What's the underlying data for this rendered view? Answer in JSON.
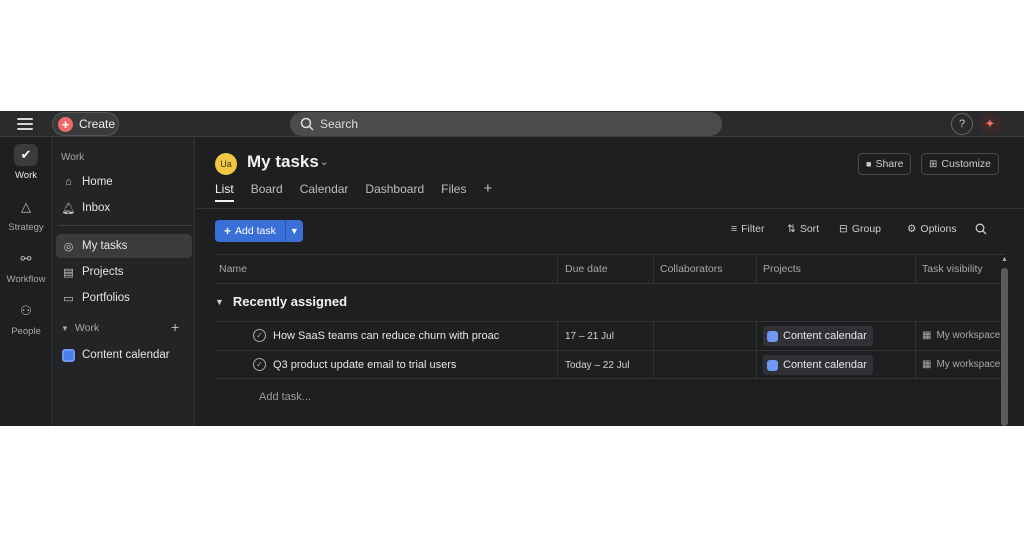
{
  "topbar": {
    "create_label": "Create",
    "search_placeholder": "Search",
    "help_label": "?"
  },
  "rail": {
    "items": [
      {
        "label": "Work",
        "icon": "check-circle-icon"
      },
      {
        "label": "Strategy",
        "icon": "triangle-icon"
      },
      {
        "label": "Workflow",
        "icon": "workflow-icon"
      },
      {
        "label": "People",
        "icon": "people-icon"
      }
    ]
  },
  "sidebar": {
    "section_label": "Work",
    "items": [
      {
        "label": "Home",
        "icon": "home-icon"
      },
      {
        "label": "Inbox",
        "icon": "bell-icon"
      },
      {
        "label": "My tasks",
        "icon": "check-circle-icon"
      },
      {
        "label": "Projects",
        "icon": "clipboard-icon"
      },
      {
        "label": "Portfolios",
        "icon": "folder-icon"
      }
    ],
    "team_label": "Work",
    "projects": [
      {
        "label": "Content calendar",
        "icon": "calendar-icon",
        "color": "#4b7bec"
      }
    ]
  },
  "main": {
    "avatar_initials": "Ua",
    "title": "My tasks",
    "share_label": "Share",
    "customize_label": "Customize",
    "tabs": [
      "List",
      "Board",
      "Calendar",
      "Dashboard",
      "Files"
    ],
    "active_tab": "List",
    "add_task_label": "Add task",
    "toolbar": {
      "filter": "Filter",
      "sort": "Sort",
      "group": "Group",
      "options": "Options"
    },
    "columns": [
      "Name",
      "Due date",
      "Collaborators",
      "Projects",
      "Task visibility"
    ],
    "section_title": "Recently assigned",
    "tasks": [
      {
        "name": "How SaaS teams can reduce churn with proac",
        "due": "17 – 21 Jul",
        "project": "Content calendar",
        "visibility": "My workspace"
      },
      {
        "name": "Q3 product update email to trial users",
        "due": "Today – 22 Jul",
        "project": "Content calendar",
        "visibility": "My workspace"
      }
    ],
    "add_task_placeholder": "Add task..."
  },
  "colors": {
    "accent": "#3b6fd8",
    "create": "#f06a6a",
    "avatar": "#f2c744",
    "project": "#6f98f2"
  }
}
